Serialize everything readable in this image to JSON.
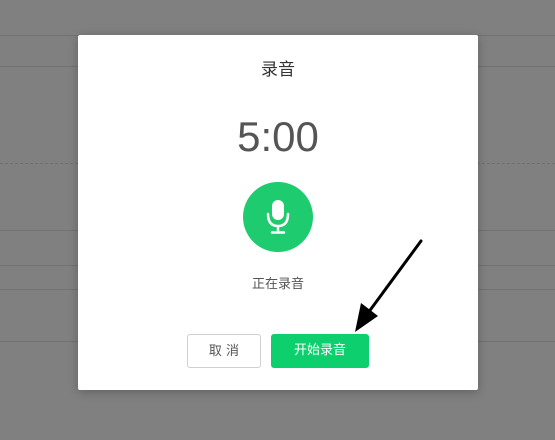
{
  "dialog": {
    "title": "录音",
    "timer": "5:00",
    "status": "正在录音",
    "cancel_label": "取 消",
    "start_label": "开始录音"
  },
  "icons": {
    "record": "microphone-icon",
    "annotation": "arrow-annotation-icon"
  },
  "colors": {
    "accent": "#0ecf6d",
    "overlay": "#808080"
  }
}
